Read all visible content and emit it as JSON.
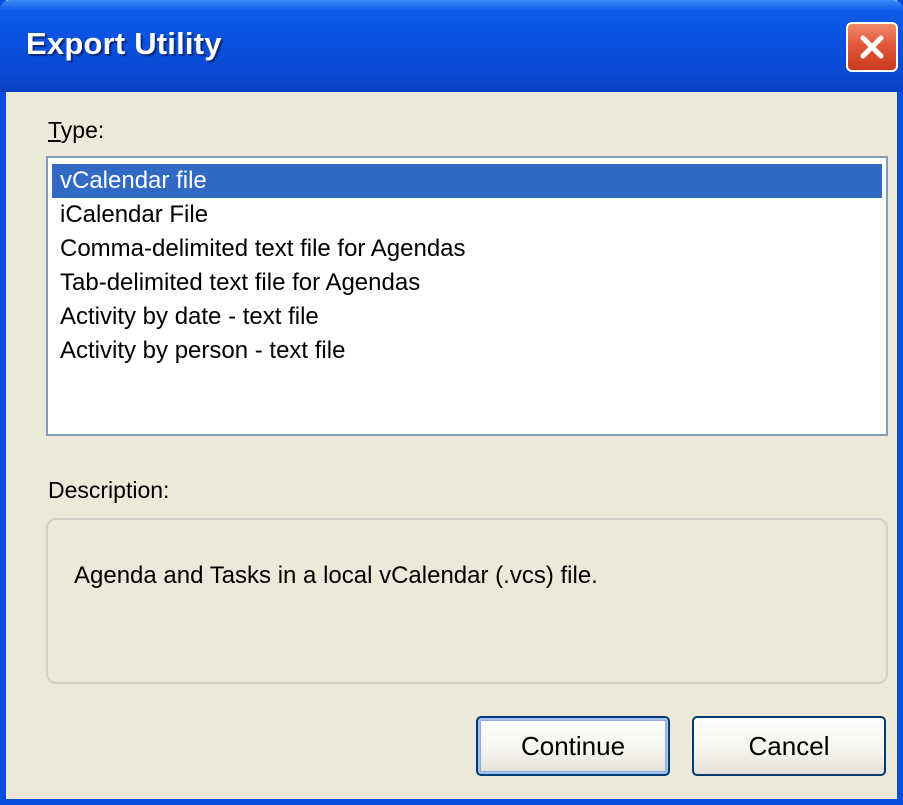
{
  "window": {
    "title": "Export Utility"
  },
  "type_section": {
    "label_accel": "T",
    "label_rest": "ype:",
    "items": [
      {
        "label": "vCalendar file",
        "selected": true
      },
      {
        "label": "iCalendar File",
        "selected": false
      },
      {
        "label": "Comma-delimited text file for Agendas",
        "selected": false
      },
      {
        "label": "Tab-delimited text file for Agendas",
        "selected": false
      },
      {
        "label": "Activity by date - text file",
        "selected": false
      },
      {
        "label": "Activity by person - text file",
        "selected": false
      }
    ]
  },
  "description_section": {
    "label": "Description:",
    "text": "Agenda and Tasks in a local vCalendar (.vcs) file."
  },
  "buttons": {
    "continue_label": "Continue",
    "cancel_label": "Cancel"
  },
  "colors": {
    "title_bar": "#0a52df",
    "selection": "#316ac5",
    "close_button": "#e2573a",
    "dialog_face": "#ece9d8"
  }
}
